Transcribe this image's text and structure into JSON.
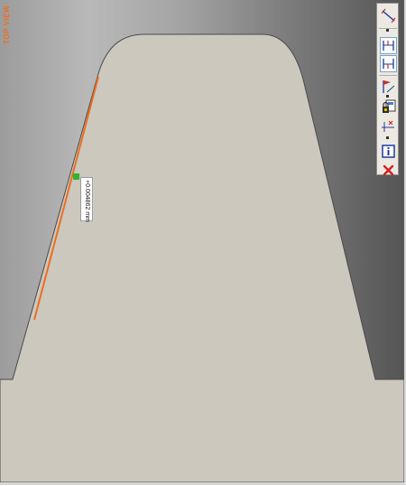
{
  "viewport": {
    "view_label": "TOP VIEW",
    "background_left": "#b9b9b9",
    "background_right": "#555555",
    "part_fill": "#ccc8be",
    "highlight_color": "#ee6e1e",
    "marker_color": "#2fb52f"
  },
  "dimension": {
    "value": "+0.004862 mm"
  },
  "toolbar": {
    "buttons": [
      {
        "name": "measure-distance-icon",
        "pressed": false
      },
      {
        "name": "edge-bracket-top-icon",
        "pressed": true
      },
      {
        "name": "edge-bracket-bottom-icon",
        "pressed": true
      },
      {
        "name": "flag-measure-icon",
        "pressed": false
      },
      {
        "name": "calculator-lock-icon",
        "pressed": false
      },
      {
        "name": "point-tolerance-icon",
        "pressed": false
      },
      {
        "name": "info-icon",
        "pressed": false
      },
      {
        "name": "close-icon",
        "pressed": false
      }
    ]
  }
}
